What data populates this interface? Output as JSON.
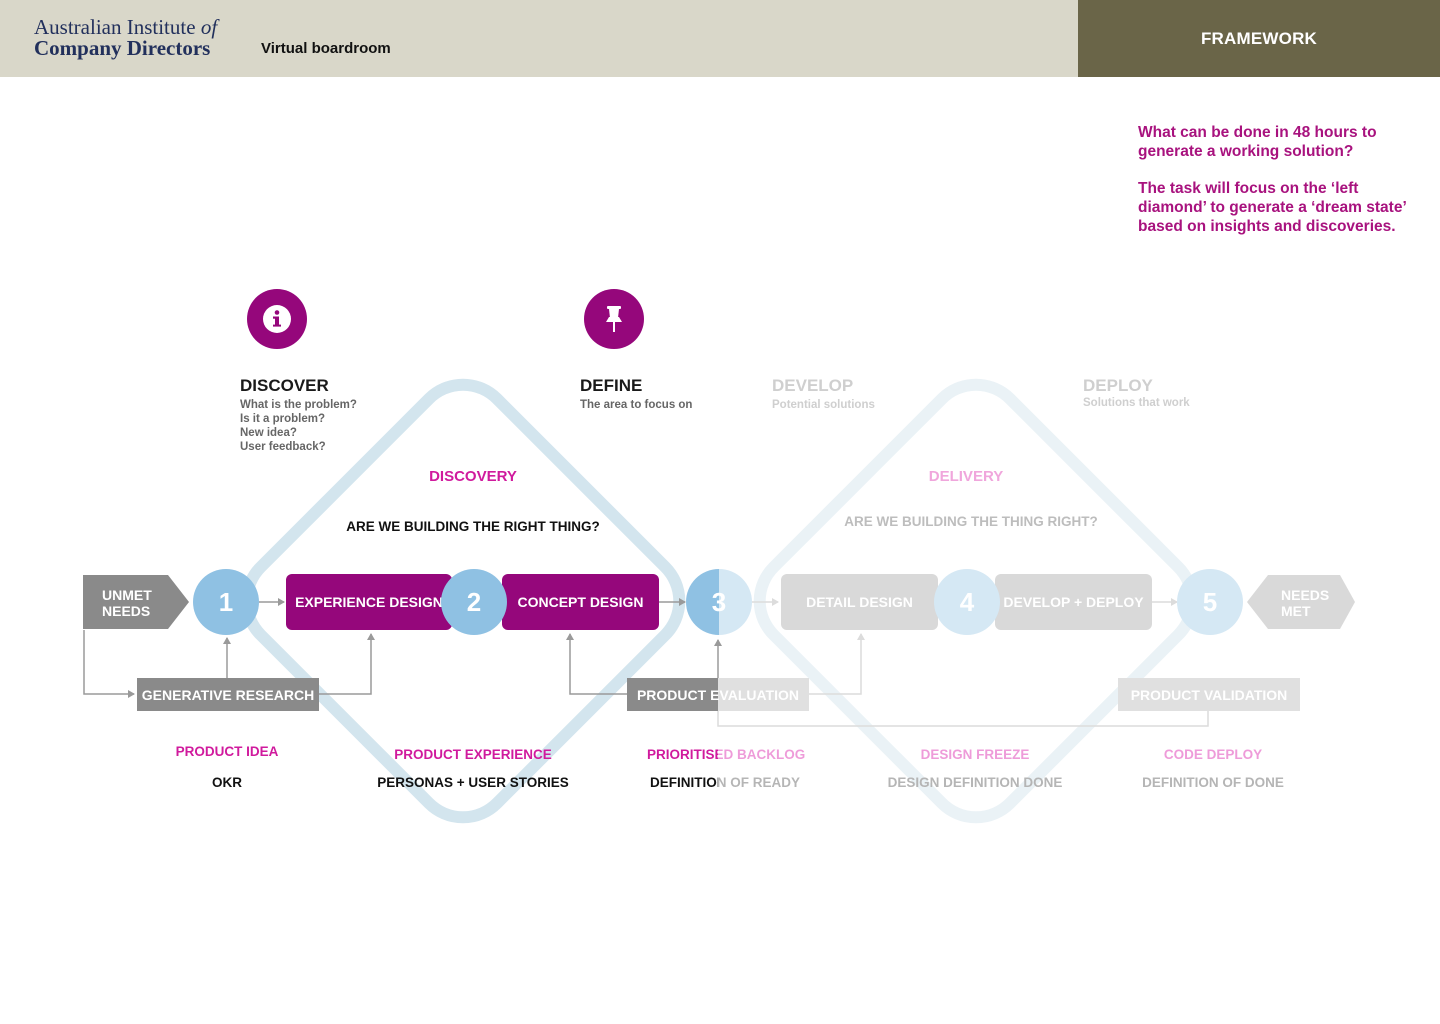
{
  "header": {
    "logo_line1": "Australian Institute",
    "logo_line1_italic": "of",
    "logo_line2": "Company Directors",
    "app_title": "Virtual boardroom",
    "tab_label": "FRAMEWORK"
  },
  "note": {
    "paragraph1": "What can be done in 48 hours to generate a working solution?",
    "paragraph2": "The task will focus on the ‘left diamond’ to generate a ‘dream state’ based on insights and discoveries."
  },
  "stages": {
    "discover": {
      "title": "DISCOVER",
      "lines": [
        "What is the problem?",
        "Is it a problem?",
        "New idea?",
        "User feedback?"
      ],
      "icon": "info-icon"
    },
    "define": {
      "title": "DEFINE",
      "lines": [
        "The area to focus on"
      ],
      "icon": "pushpin-icon"
    },
    "develop": {
      "title": "DEVELOP",
      "lines": [
        "Potential solutions"
      ]
    },
    "deploy": {
      "title": "DEPLOY",
      "lines": [
        "Solutions that work"
      ]
    }
  },
  "diamonds": {
    "discovery": {
      "label": "DISCOVERY",
      "question": "ARE WE BUILDING THE RIGHT THING?"
    },
    "delivery": {
      "label": "DELIVERY",
      "question": "ARE WE BUILDING THE THING RIGHT?"
    }
  },
  "flow": {
    "start": [
      "UNMET",
      "NEEDS"
    ],
    "end": [
      "NEEDS",
      "MET"
    ],
    "steps": [
      "1",
      "2",
      "3",
      "4",
      "5"
    ],
    "boxes": {
      "experience_design": "EXPERIENCE DESIGN",
      "concept_design": "CONCEPT DESIGN",
      "detail_design": "DETAIL DESIGN",
      "develop_deploy": "DEVELOP + DEPLOY",
      "generative_research": "GENERATIVE RESEARCH",
      "product_evaluation": "PRODUCT EVALUATION",
      "product_validation": "PRODUCT VALIDATION"
    }
  },
  "outputs": [
    {
      "top": "PRODUCT IDEA",
      "bottom": "OKR"
    },
    {
      "top": "PRODUCT EXPERIENCE",
      "bottom": "PERSONAS + USER STORIES"
    },
    {
      "top": "PRIORITISED BACKLOG",
      "bottom": "DEFINITION OF READY"
    },
    {
      "top": "DESIGN FREEZE",
      "bottom": "DESIGN DEFINITION DONE"
    },
    {
      "top": "CODE DEPLOY",
      "bottom": "DEFINITION OF DONE"
    }
  ],
  "colors": {
    "brand_purple": "#95077b",
    "accent_pink": "#d01a9d",
    "step_blue": "#8fc1e3",
    "diamond_stroke": "#d3e5ee",
    "header_bg": "#d9d7c9",
    "tab_bg": "#6a6548"
  }
}
